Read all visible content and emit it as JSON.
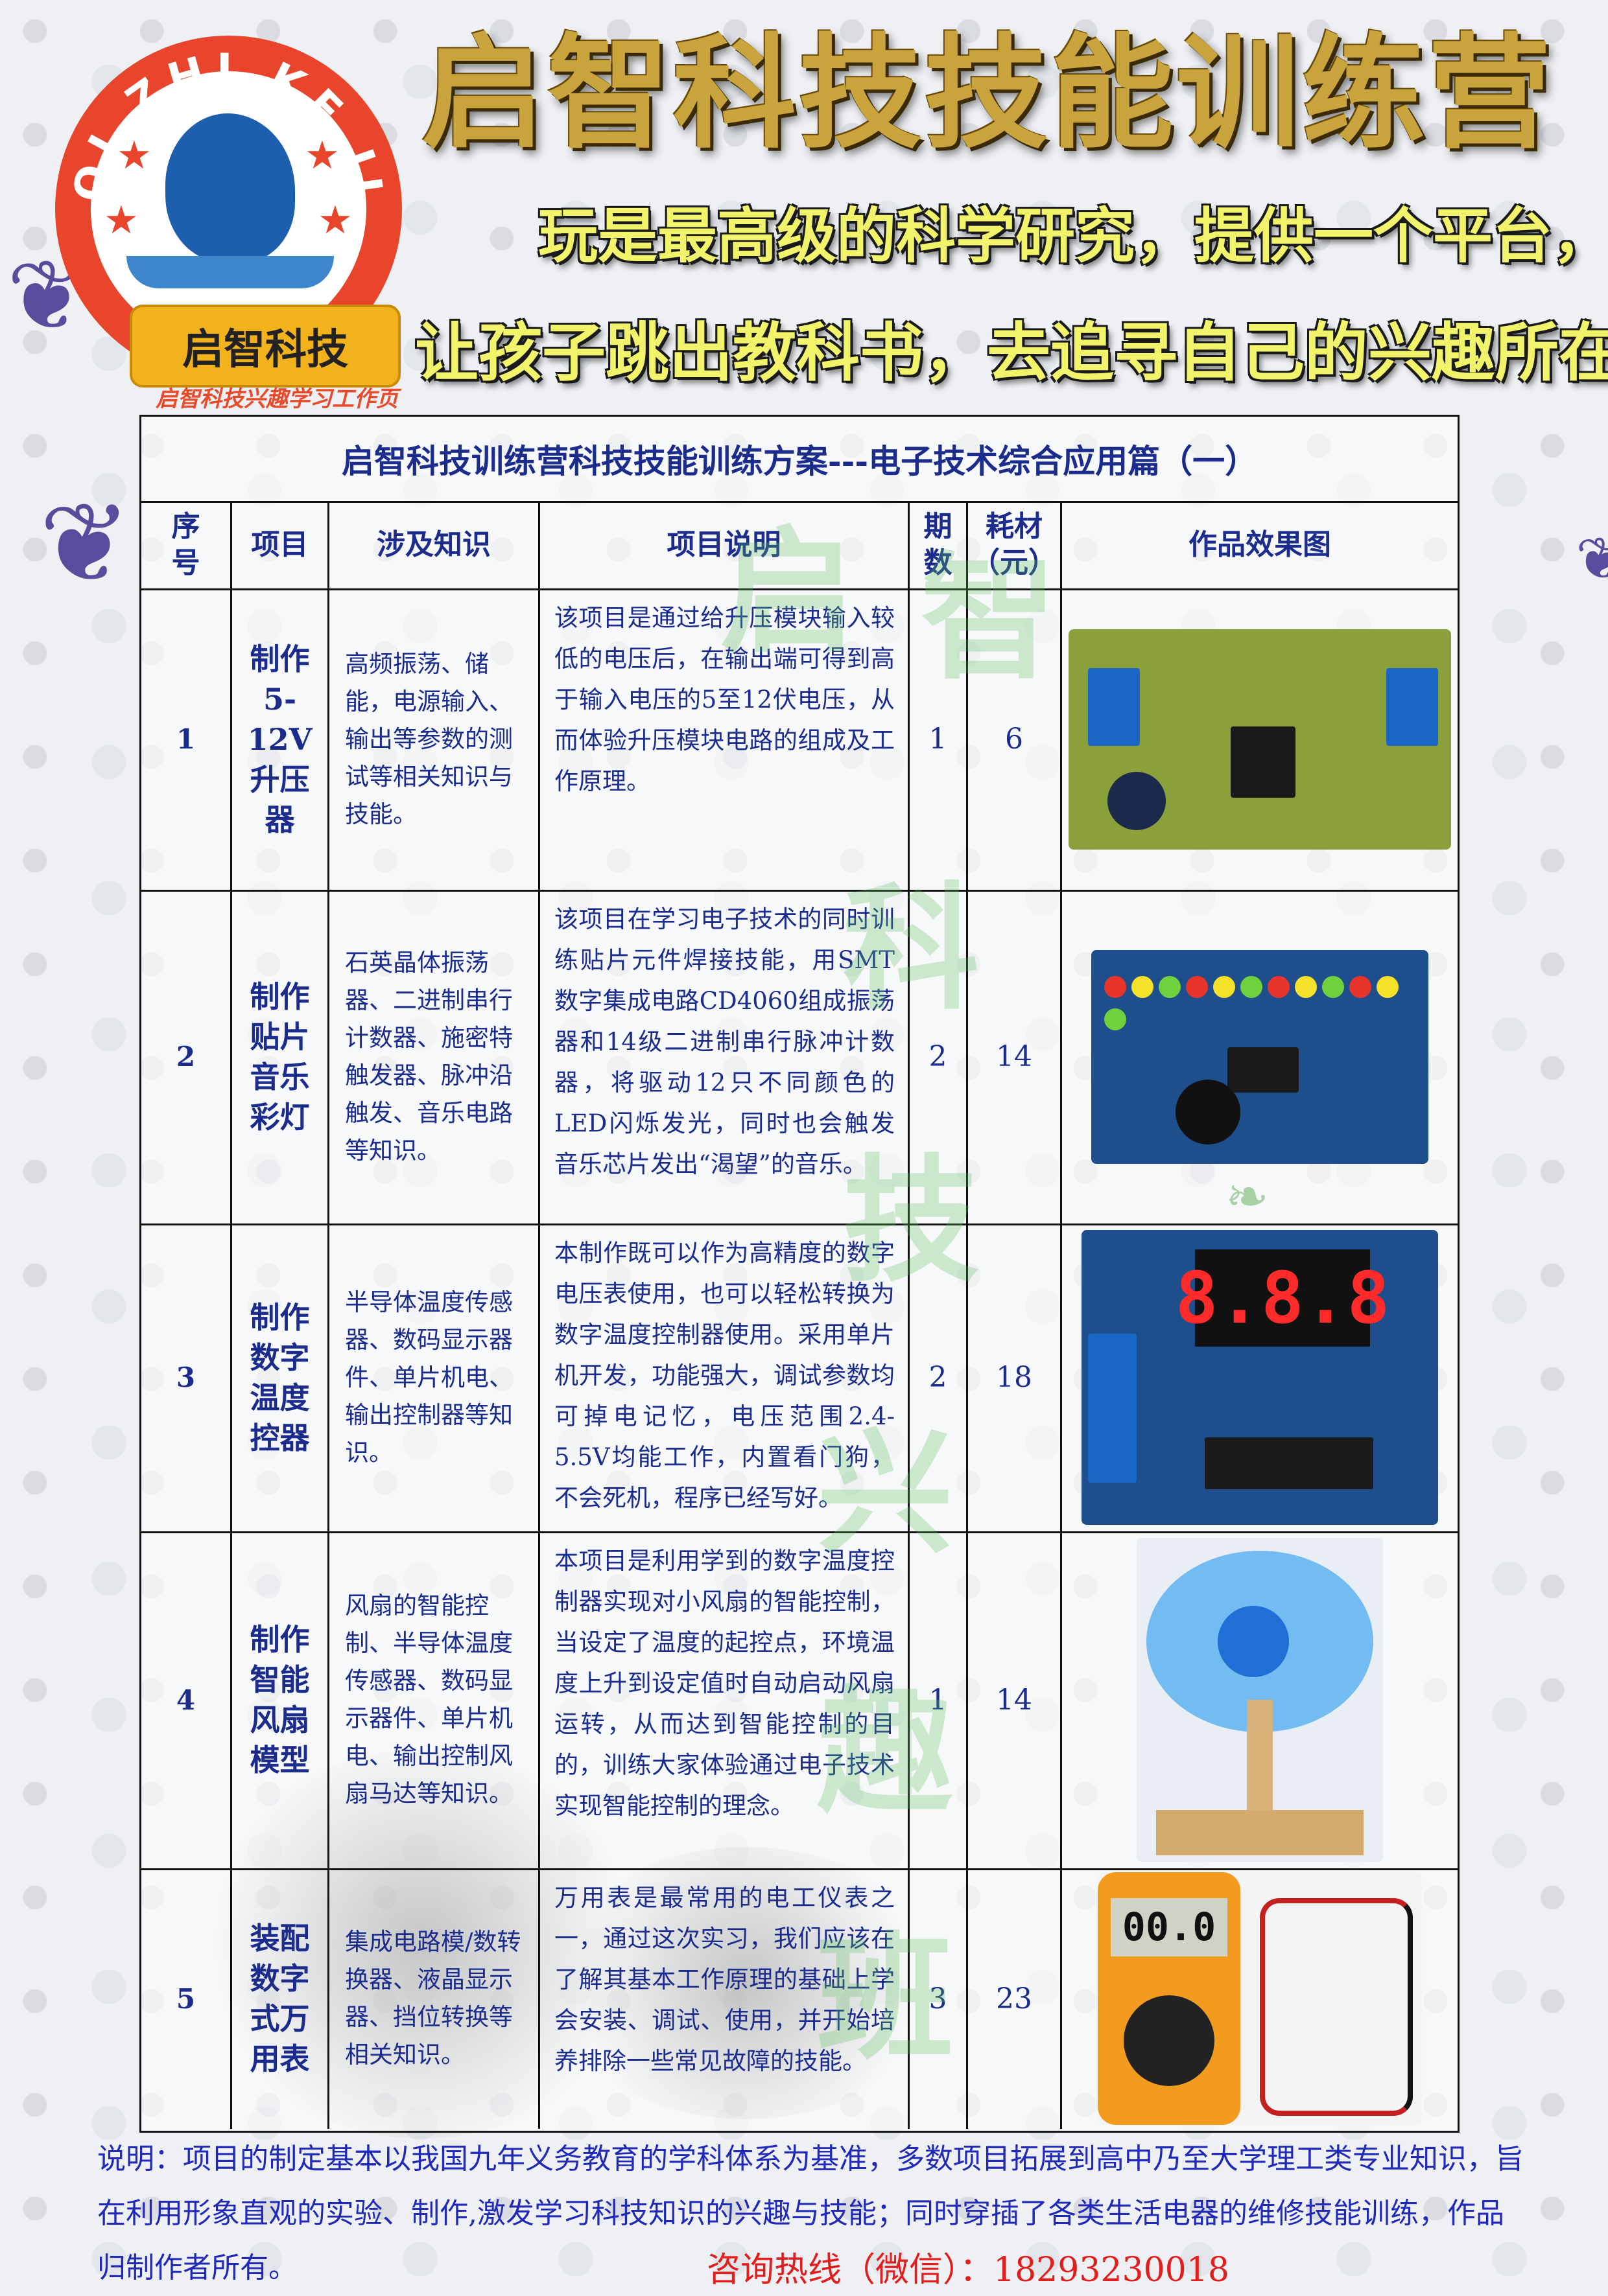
{
  "header": {
    "logo_ring_text": "QI ZHI KE JI",
    "logo_banner": "启智科技",
    "title": "启智科技技能训练营",
    "slogan_line1": "玩是最高级的科学研究，提供一个平台，",
    "slogan_line2": "让孩子跳出教科书，去追寻自己的兴趣所在。",
    "caption": "启智科技兴趣学习工作页"
  },
  "table": {
    "title": "启智科技训练营科技技能训练方案---电子技术综合应用篇（一）",
    "headers": {
      "no": "序号",
      "project": "项目",
      "knowledge": "涉及知识",
      "description": "项目说明",
      "terms": "期数",
      "cost": "耗材（元）",
      "image": "作品效果图"
    },
    "rows": [
      {
        "no": "1",
        "project": "制作5-12V升压器",
        "knowledge": "高频振荡、储能，电源输入、输出等参数的测试等相关知识与技能。",
        "description": "该项目是通过给升压模块输入较低的电压后，在输出端可得到高于输入电压的5至12伏电压，从而体验升压模块电路的组成及工作原理。",
        "terms": "1",
        "cost": "6"
      },
      {
        "no": "2",
        "project": "制作贴片音乐彩灯",
        "knowledge": "石英晶体振荡器、二进制串行计数器、施密特触发器、脉冲沿触发、音乐电路等知识。",
        "description": "该项目在学习电子技术的同时训练贴片元件焊接技能，用SMT数字集成电路CD4060组成振荡器和14级二进制串行脉冲计数器，将驱动12只不同颜色的LED闪烁发光，同时也会触发音乐芯片发出“渴望”的音乐。",
        "terms": "2",
        "cost": "14"
      },
      {
        "no": "3",
        "project": "制作数字温度控器",
        "knowledge": "半导体温度传感器、数码显示器件、单片机电、输出控制器等知识。",
        "description": "本制作既可以作为高精度的数字电压表使用，也可以轻松转换为数字温度控制器使用。采用单片机开发，功能强大，调试参数均可掉电记忆，电压范围2.4-5.5V均能工作，内置看门狗，不会死机，程序已经写好。",
        "terms": "2",
        "cost": "18"
      },
      {
        "no": "4",
        "project": "制作智能风扇模型",
        "knowledge": "风扇的智能控制、半导体温度传感器、数码显示器件、单片机电、输出控制风扇马达等知识。",
        "description": "本项目是利用学到的数字温度控制器实现对小风扇的智能控制，当设定了温度的起控点，环境温度上升到设定值时自动启动风扇运转，从而达到智能控制的目的，训练大家体验通过电子技术实现智能控制的理念。",
        "terms": "1",
        "cost": "14"
      },
      {
        "no": "5",
        "project": "装配数字式万用表",
        "knowledge": "集成电路模/数转换器、液晶显示器、挡位转换等相关知识。",
        "description": "万用表是最常用的电工仪表之一，通过这次实习，我们应该在了解其基本工作原理的基础上学会安装、调试、使用，并开始培养排除一些常见故障的技能。",
        "terms": "3",
        "cost": "23"
      }
    ]
  },
  "photos": {
    "display_reading": "8.8.8",
    "meter_reading": "00.0"
  },
  "watermark": [
    "启",
    "智",
    "科",
    "技",
    "兴",
    "趣",
    "班"
  ],
  "footer": {
    "note": "说明：项目的制定基本以我国九年义务教育的学科体系为基准，多数项目拓展到高中乃至大学理工类专业知识，旨在利用形象直观的实验、制作,激发学习科技知识的兴趣与技能；同时穿插了各类生活电器的维修技能训练，作品归制作者所有。",
    "hotline": "咨询热线（微信）：18293230018"
  },
  "colors": {
    "text_blue": "#1b2c8c",
    "note_blue": "#2029b8",
    "hotline_red": "#e31c1c",
    "title_gold": "#c9a33c",
    "slogan_yellow": "#f1f36a",
    "logo_red": "#e8452c"
  }
}
